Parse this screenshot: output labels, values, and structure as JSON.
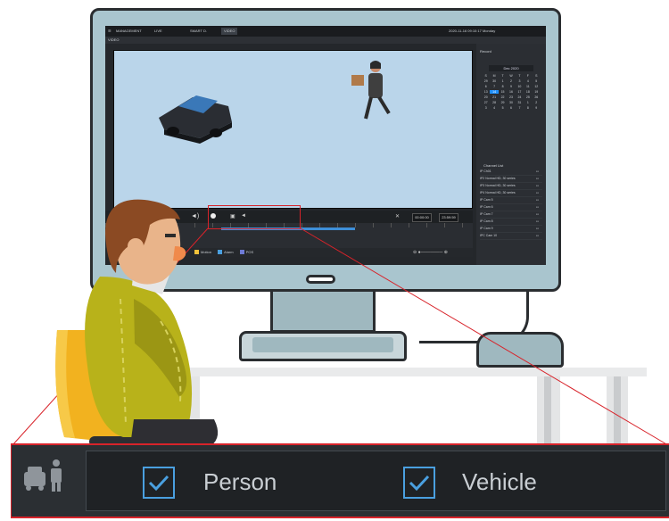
{
  "app": {
    "tabs": [
      "MANAGEMENT",
      "LIVE",
      "SMART D.",
      "VIDEO"
    ],
    "subbar_title": "VIDEO",
    "datetime": "2020-11-16 09:10:17 Monday",
    "right_panel_title": "Record",
    "calendar_month": "Dec 2020",
    "calendar_days_header": [
      "S",
      "M",
      "T",
      "W",
      "T",
      "F",
      "S"
    ],
    "calendar_days": [
      "29",
      "30",
      "1",
      "2",
      "3",
      "4",
      "5",
      "6",
      "7",
      "8",
      "9",
      "10",
      "11",
      "12",
      "13",
      "14",
      "15",
      "16",
      "17",
      "18",
      "19",
      "20",
      "21",
      "22",
      "23",
      "24",
      "25",
      "26",
      "27",
      "28",
      "29",
      "30",
      "31",
      "1",
      "2",
      "3",
      "4",
      "5",
      "6",
      "7",
      "8",
      "9"
    ],
    "selected_day_index": 15,
    "channel_list_title": "Channel List",
    "channels": [
      "IP Ch01",
      "IP2 Normal HD, 30 series",
      "IP3 Normal HD, 30 series",
      "IP4 Normal HD, 30 series",
      "IP Cam 5",
      "IP Cam 6",
      "IP Cam 7",
      "IP Cam 8",
      "IP Cam 9",
      "IPC Cam 10"
    ],
    "time_start": "00:00:00",
    "time_end": "23:59:59",
    "legend": [
      "Motion",
      "Alarm",
      "POS"
    ]
  },
  "callout": {
    "filter_icon": "person-vehicle-filter-icon",
    "person_label": "Person",
    "vehicle_label": "Vehicle",
    "person_checked": true,
    "vehicle_checked": true
  },
  "colors": {
    "accent_red": "#d8232a",
    "checkbox_blue": "#4aa0e0",
    "panel_dark": "#1f2225"
  }
}
